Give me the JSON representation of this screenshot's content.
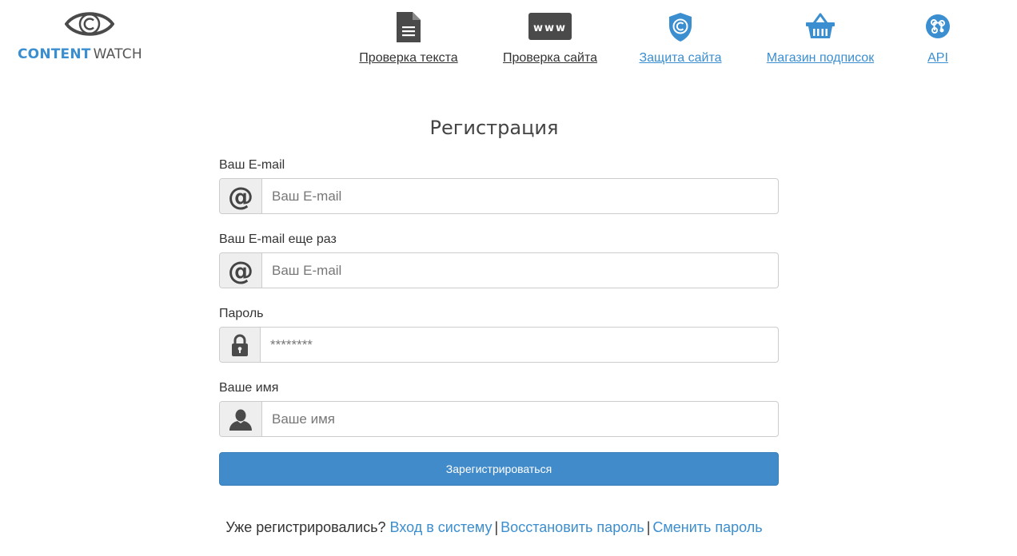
{
  "logo": {
    "word1": "CONTENT",
    "word2": "WATCH",
    "icon": "eye-copyright-icon"
  },
  "nav": [
    {
      "label": "Проверка текста",
      "icon": "document-icon",
      "color": "#333333"
    },
    {
      "label": "Проверка сайта",
      "icon": "www-icon",
      "color": "#333333"
    },
    {
      "label": "Защита сайта",
      "icon": "shield-copyright-icon",
      "color": "#3b8ed0"
    },
    {
      "label": "Магазин подписок",
      "icon": "basket-icon",
      "color": "#3b8ed0"
    },
    {
      "label": "API",
      "icon": "api-nodes-icon",
      "color": "#3b8ed0"
    }
  ],
  "www_icon_text": "www",
  "page_title": "Регистрация",
  "form": {
    "email": {
      "label": "Ваш E-mail",
      "placeholder": "Ваш E-mail",
      "icon": "at-icon",
      "value": ""
    },
    "email_repeat": {
      "label": "Ваш E-mail еще раз",
      "placeholder": "Ваш E-mail",
      "icon": "at-icon",
      "value": ""
    },
    "password": {
      "label": "Пароль",
      "placeholder": "********",
      "icon": "lock-icon",
      "value": ""
    },
    "name": {
      "label": "Ваше имя",
      "placeholder": "Ваше имя",
      "icon": "user-icon",
      "value": ""
    },
    "at_symbol": "@",
    "submit_label": "Зарегистрироваться"
  },
  "footer": {
    "prompt": "Уже регистрировались?",
    "login": "Вход в систему",
    "restore": "Восстановить пароль",
    "change": "Сменить пароль",
    "separator": "|"
  },
  "colors": {
    "accent": "#428bca",
    "link": "#3b8ed0",
    "icon_dark": "#4a4a4a"
  }
}
